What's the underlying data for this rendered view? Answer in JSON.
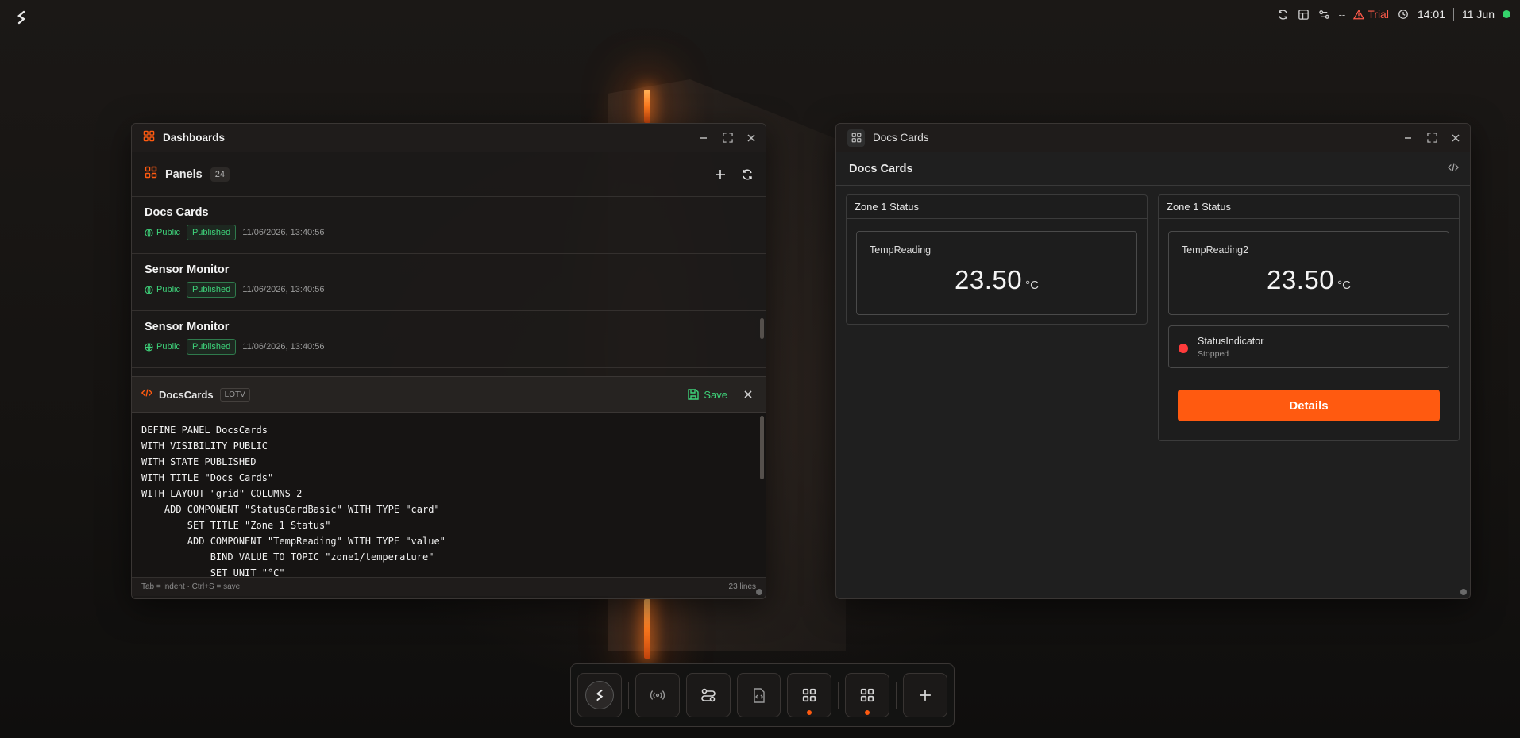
{
  "topbar": {
    "sync_text": "--",
    "trial_label": "Trial",
    "time": "14:01",
    "date": "11 Jun"
  },
  "dashboards_window": {
    "title": "Dashboards",
    "panels_title": "Panels",
    "panels_count": "24",
    "panels": [
      {
        "name": "Docs Cards",
        "visibility": "Public",
        "state": "Published",
        "timestamp": "11/06/2026, 13:40:56"
      },
      {
        "name": "Sensor Monitor",
        "visibility": "Public",
        "state": "Published",
        "timestamp": "11/06/2026, 13:40:56"
      },
      {
        "name": "Sensor Monitor",
        "visibility": "Public",
        "state": "Published",
        "timestamp": "11/06/2026, 13:40:56"
      }
    ],
    "editor": {
      "name": "DocsCards",
      "language": "LOTV",
      "save_label": "Save",
      "code": "DEFINE PANEL DocsCards\nWITH VISIBILITY PUBLIC\nWITH STATE PUBLISHED\nWITH TITLE \"Docs Cards\"\nWITH LAYOUT \"grid\" COLUMNS 2\n    ADD COMPONENT \"StatusCardBasic\" WITH TYPE \"card\"\n        SET TITLE \"Zone 1 Status\"\n        ADD COMPONENT \"TempReading\" WITH TYPE \"value\"\n            BIND VALUE TO TOPIC \"zone1/temperature\"\n            SET UNIT \"°C\"",
      "hint": "Tab = indent · Ctrl+S = save",
      "lines": "23 lines"
    }
  },
  "docs_window": {
    "title": "Docs Cards",
    "header_title": "Docs Cards",
    "cards": [
      {
        "title": "Zone 1 Status",
        "value_label": "TempReading",
        "value": "23.50",
        "unit": "°C"
      },
      {
        "title": "Zone 1 Status",
        "value_label": "TempReading2",
        "value": "23.50",
        "unit": "°C",
        "status_name": "StatusIndicator",
        "status_state": "Stopped",
        "button_label": "Details"
      }
    ]
  },
  "dock": {
    "items": [
      "home-icon",
      "broadcast-icon",
      "flows-icon",
      "code-file-icon",
      "dashboard-icon",
      "dashboard-icon",
      "add-icon"
    ]
  },
  "colors": {
    "accent": "#ff5a10",
    "published": "#3ed37a",
    "status_stopped": "#ff3b3b",
    "trial": "#ff5a4a",
    "online": "#35d36b"
  }
}
